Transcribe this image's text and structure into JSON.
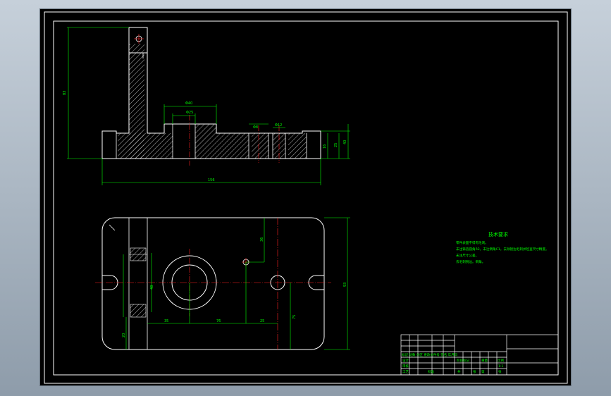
{
  "drawing": {
    "technical_requirements": {
      "title": "技术要求",
      "items": [
        "零件表面不得有毛刺。",
        "未注铸造圆角R2。未注倒角C1。去除锐边毛刺并检查尺寸精度。",
        "未注尺寸公差。",
        "去毛刺锐边。倒角。"
      ]
    },
    "dimensions": {
      "front_height": "83",
      "bore_outer": "Φ40",
      "bore_inner": "Φ25",
      "hole_a": "Φ8",
      "hole_b": "Φ12",
      "right_h1": "40",
      "right_h2": "25",
      "right_h3": "16",
      "overall_length": "156",
      "top_vertical": "36",
      "left_side": "48",
      "bottom_x1": "35",
      "bottom_x2": "76",
      "bottom_x3": "25",
      "right_v": "75",
      "overall_width": "93",
      "left_vertical": "20"
    },
    "title_block": {
      "row_labels": [
        "设计",
        "标记 处数 分区 更改文件号 签名 年月日",
        "审核",
        "工艺",
        "批准"
      ],
      "stage_label": "阶段标记",
      "weight_label": "重量",
      "scale_label": "比例",
      "scale_value": "1:1",
      "sheet_labels": [
        "共",
        "张",
        "第",
        "张"
      ]
    }
  }
}
